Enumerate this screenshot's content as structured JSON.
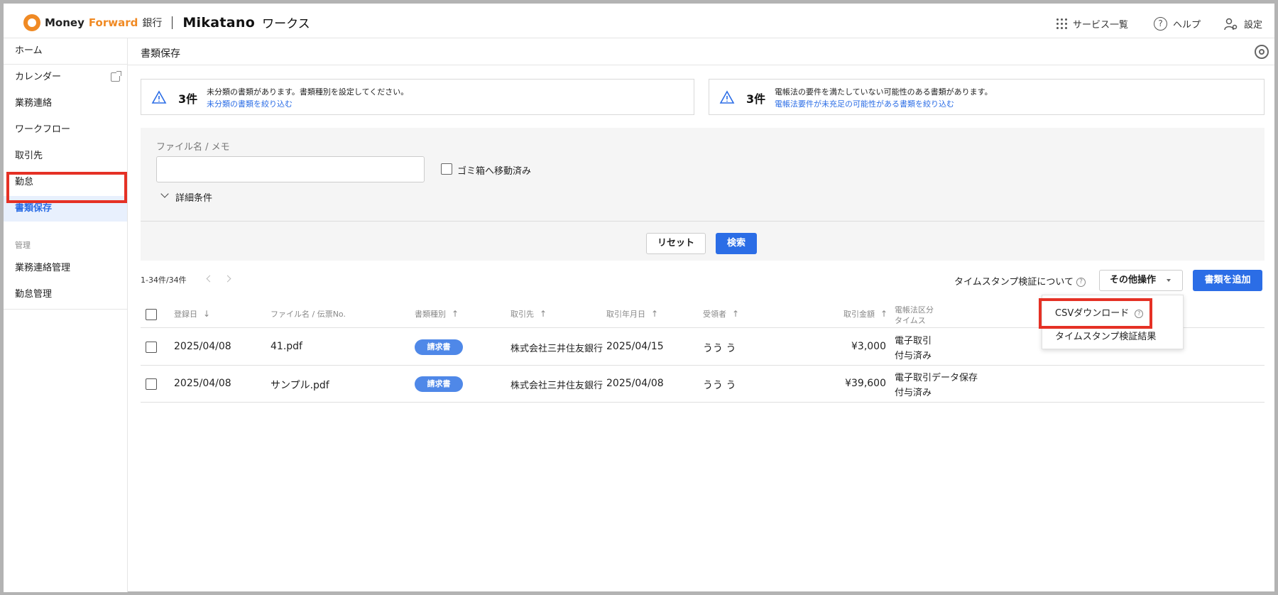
{
  "header": {
    "brand_money": "Money ",
    "brand_forward": "Forward",
    "brand_bank": "銀行",
    "brand_mikatano": "Mikatano",
    "brand_works": "ワークス",
    "nav": {
      "services": "サービス一覧",
      "help": "ヘルプ",
      "settings": "設定"
    }
  },
  "sidebar": {
    "home": "ホーム",
    "items": [
      {
        "label": "カレンダー"
      },
      {
        "label": "業務連絡"
      },
      {
        "label": "ワークフロー"
      },
      {
        "label": "取引先"
      },
      {
        "label": "勤怠"
      },
      {
        "label": "書類保存"
      }
    ],
    "section_label": "管理",
    "admin_items": [
      {
        "label": "業務連絡管理"
      },
      {
        "label": "勤怠管理"
      }
    ]
  },
  "main": {
    "page_title": "書類保存",
    "alerts": [
      {
        "count": "3件",
        "message": "未分類の書類があります。書類種別を設定してください。",
        "link": "未分類の書類を絞り込む"
      },
      {
        "count": "3件",
        "message": "電帳法の要件を満たしていない可能性のある書類があります。",
        "link": "電帳法要件が未充足の可能性がある書類を絞り込む"
      }
    ],
    "search": {
      "filename_label": "ファイル名 / メモ",
      "filename_value": "",
      "trash_label": "ゴミ箱へ移動済み",
      "detail_label": "詳細条件",
      "reset_label": "リセット",
      "search_label": "検索"
    },
    "pager_text": "1-34件/34件",
    "timestamp_about": "タイムスタンプ検証について",
    "other_ops_label": "その他操作",
    "add_doc_label": "書類を追加",
    "dropdown": {
      "items": [
        "CSVダウンロード",
        "タイムスタンプ検証結果"
      ]
    },
    "table": {
      "headers": [
        "登録日",
        "ファイル名 / 伝票No.",
        "書類種別",
        "取引先",
        "取引年月日",
        "受領者",
        "取引金額",
        "電帳法区分",
        "タイムス"
      ],
      "rows": [
        {
          "registered": "2025/04/08",
          "filename": "41.pdf",
          "doc_type": "請求書",
          "partner": "株式会社三井住友銀行",
          "date": "2025/04/15",
          "receiver": "うう う",
          "amount": "¥3,000",
          "ebook_line1": "電子取引",
          "ebook_line2": "付与済み"
        },
        {
          "registered": "2025/04/08",
          "filename": "サンプル.pdf",
          "doc_type": "請求書",
          "partner": "株式会社三井住友銀行",
          "date": "2025/04/08",
          "receiver": "うう う",
          "amount": "¥39,600",
          "ebook_line1": "電子取引データ保存",
          "ebook_line2": "付与済み"
        }
      ]
    }
  },
  "colors": {
    "accent": "#2b6de6",
    "brand_orange": "#f08a24",
    "highlight_red": "#e53125"
  }
}
